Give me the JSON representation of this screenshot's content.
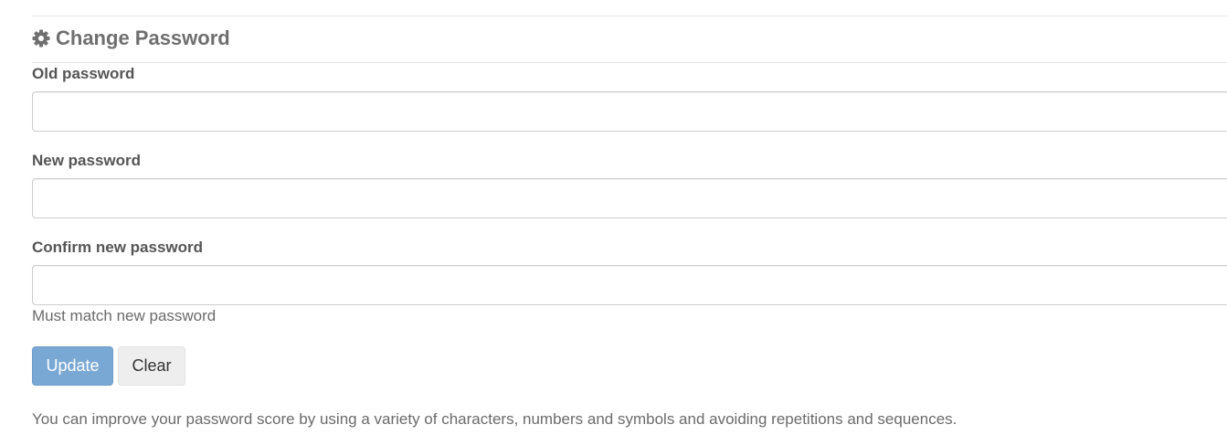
{
  "section": {
    "icon": "gear-icon",
    "title": "Change Password"
  },
  "form": {
    "old_password": {
      "label": "Old password",
      "value": "",
      "placeholder": ""
    },
    "new_password": {
      "label": "New password",
      "value": "",
      "placeholder": ""
    },
    "confirm_password": {
      "label": "Confirm new password",
      "value": "",
      "placeholder": "",
      "help": "Must match new password"
    }
  },
  "buttons": {
    "update_label": "Update",
    "clear_label": "Clear"
  },
  "hint": "You can improve your password score by using a variety of characters, numbers and symbols and avoiding repetitions and sequences.",
  "colors": {
    "update_button": "#7aa8d4",
    "clear_button": "#eeeeee",
    "title_text": "#6f6f6f",
    "label_text": "#555555"
  }
}
